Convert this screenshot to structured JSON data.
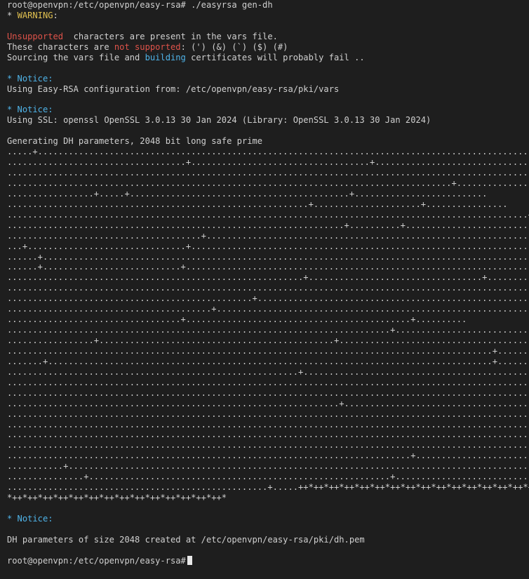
{
  "prompt": "root@openvpn:/etc/openvpn/easy-rsa#",
  "command": " ./easyrsa gen-dh",
  "warning": {
    "prefix": "* ",
    "label": "WARNING",
    "suffix": ":",
    "unsupported_word": "Unsupported",
    "unsupported_rest": "  characters are present in the vars file.",
    "chars_pre": "These characters are ",
    "chars_not_supported": "not supported",
    "chars_post": ": (') (&) (`) ($) (#)",
    "sourcing_pre": "Sourcing the vars file and ",
    "sourcing_building": "building",
    "sourcing_post": " certificates will probably fail .."
  },
  "notices": {
    "label": "* Notice:",
    "config_line": "Using Easy-RSA configuration from: /etc/openvpn/easy-rsa/pki/vars",
    "ssl_line": "Using SSL: openssl OpenSSL 3.0.13 30 Jan 2024 (Library: OpenSSL 3.0.13 30 Jan 2024)"
  },
  "generating_line": "Generating DH parameters, 2048 bit long safe prime",
  "progress_lines": [
    ".....+................................................................................................",
    "...................................+...................................+..............................",
    "..........................................................................................................",
    ".......................................................................................+..............",
    ".................+.....+...........................................+..........................",
    "...........................................................+.....................+................",
    "......................................................................................................+",
    "..................................................................+..........+.........................",
    "......................................+......................................................................",
    "...+...............................+...................................................................",
    "......+................................................................................................",
    "......+...........................+.....................................................................",
    "..........................................................+..................................+........",
    "..........................................................................................................",
    "................................................+......................................................",
    "........................................+..................................................................",
    "..................................+............................................+..........",
    "...........................................................................+...............................",
    ".................+..............................................+...........................................",
    "...............................................................................................+..........",
    ".......+.......................................................................................+........",
    ".........................................................+.....................................................",
    "..........................................................................................................",
    "..........................................................................................................",
    ".................................................................+..........................................",
    "..........................................................................................................",
    "..........................................................................................................",
    "..........................................................................................................",
    "..........................................................................................................",
    "...............................................................................+..........................",
    "...........+..............................................................................................",
    "...............+...........................................................+..........................",
    "...................................................+.....++*++*++*++*++*++*++*++*++*++*++*++*++*++*++*++*",
    "*++*++*++*++*++*++*++*++*++*++*++*++*++*++*"
  ],
  "dh_notice_label": "* Notice:",
  "dh_result": "DH parameters of size 2048 created at /etc/openvpn/easy-rsa/pki/dh.pem",
  "final_prompt": "root@openvpn:/etc/openvpn/easy-rsa#"
}
